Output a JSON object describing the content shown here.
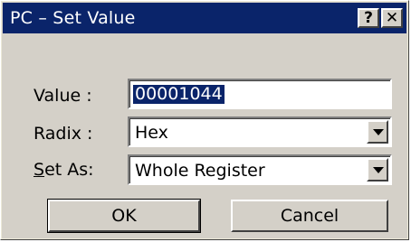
{
  "window": {
    "title": "PC – Set Value",
    "help_label": "?",
    "close_label": "✕"
  },
  "value_row": {
    "label": "Value :",
    "value": "00001044"
  },
  "radix_row": {
    "label": "Radix :",
    "selected": "Hex"
  },
  "setas_row": {
    "label_mnemonic": "S",
    "label_rest": "et As:",
    "selected": "Whole Register"
  },
  "buttons": {
    "ok": "OK",
    "cancel": "Cancel"
  },
  "colors": {
    "title_bar": "#0a246a",
    "face": "#d4d0c8",
    "selection": "#0a246a"
  }
}
